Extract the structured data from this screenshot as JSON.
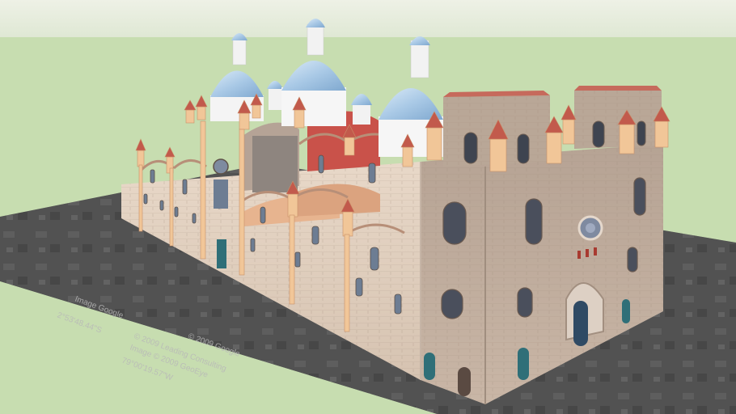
{
  "scene": {
    "credits": [
      "© 2009 Google",
      "© 2009 Leading Consulting",
      "Image © 2009 GeoEye",
      "79°00'19.57\"W"
    ],
    "credit_partial": "2°53'48.44\"S",
    "credit_partial_2": "Image Google"
  },
  "colors": {
    "sky": "#e6ecdf",
    "grass": "#c7ddb0",
    "ground": "#555555",
    "stone": "#d9c7b8",
    "dome": "#a9c9e6",
    "roof": "#c25a4c",
    "pinnacle": "#f2c79a"
  }
}
